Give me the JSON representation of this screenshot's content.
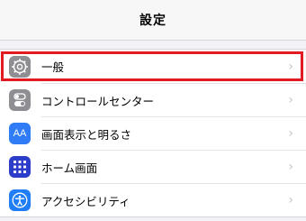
{
  "nav": {
    "title": "設定"
  },
  "items": [
    {
      "label": "一般",
      "icon": "gear-icon",
      "color": "#8e8e93"
    },
    {
      "label": "コントロールセンター",
      "icon": "toggle-icon",
      "color": "#8e8e93"
    },
    {
      "label": "画面表示と明るさ",
      "icon": "text-size-icon",
      "icon_text": "AA",
      "color": "#2f7cf6"
    },
    {
      "label": "ホーム画面",
      "icon": "home-grid-icon",
      "color": "#2c3dc9"
    },
    {
      "label": "アクセシビリティ",
      "icon": "accessibility-icon",
      "color": "#1f7ef5"
    }
  ],
  "highlight_color": "#e21b22"
}
